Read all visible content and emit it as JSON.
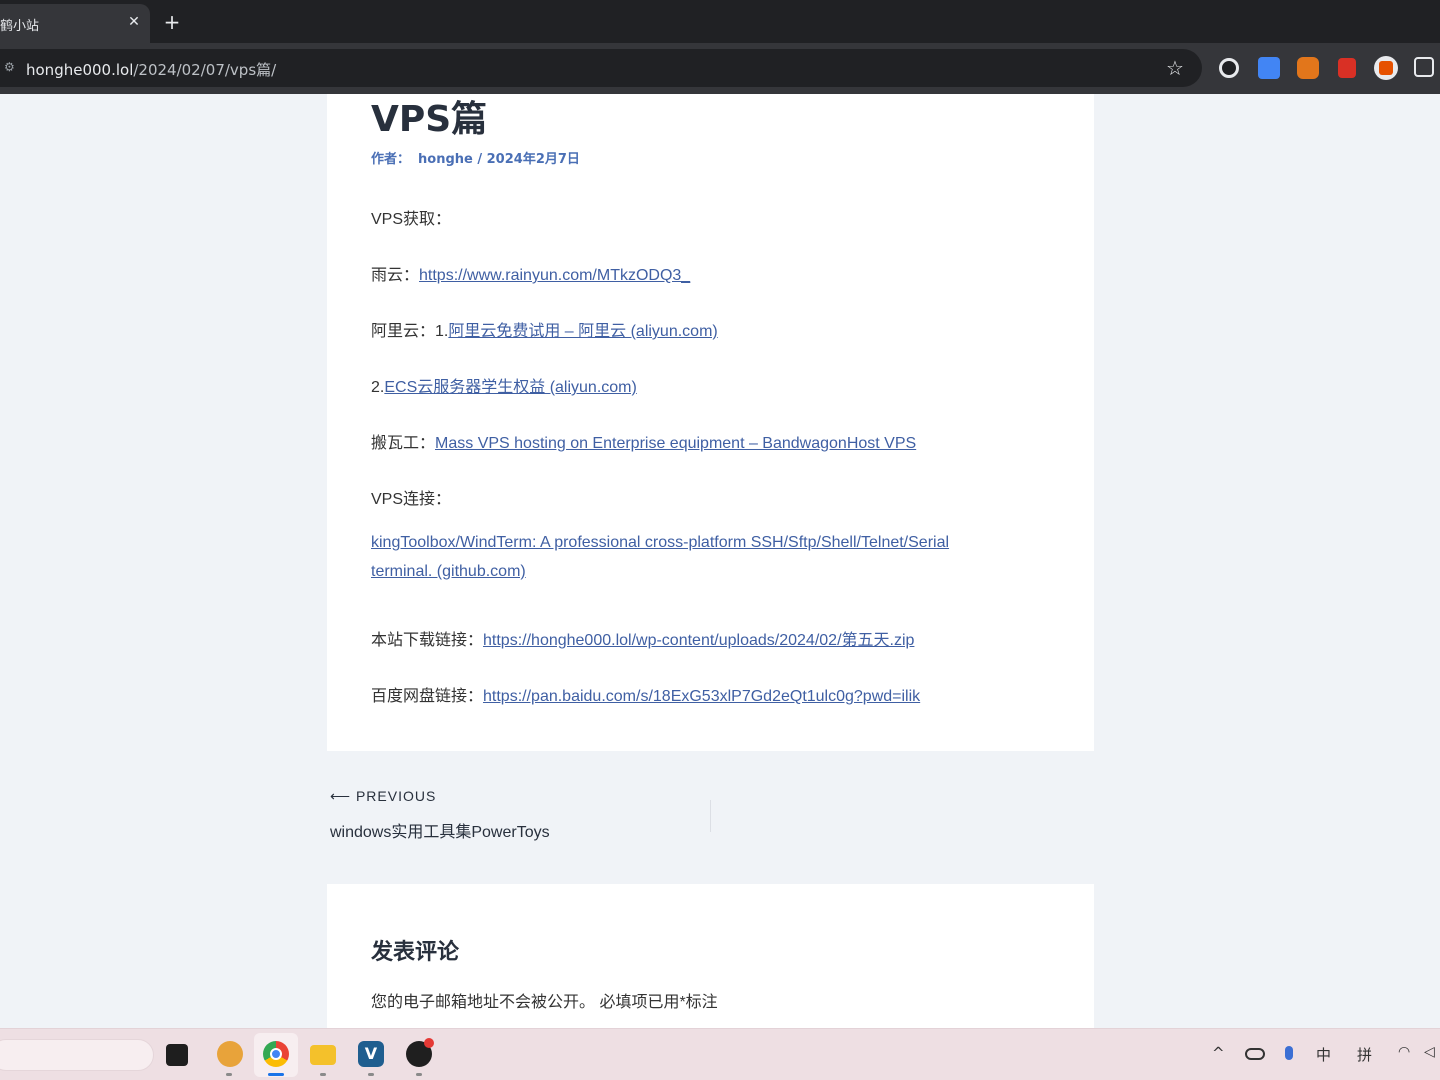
{
  "browser": {
    "tab_title": "鹤小站",
    "tab_close": "✕",
    "new_tab": "+",
    "url_host": "honghe000.lol",
    "url_path": "/2024/02/07/vps篇/",
    "icons": [
      "site-info-icon",
      "star-icon",
      "extension-icons"
    ]
  },
  "post": {
    "title": "VPS篇",
    "meta_author_label": "作者：",
    "meta_author_date": "honghe / 2024年2月7日",
    "lines": [
      {
        "prefix": "VPS获取：",
        "link": ""
      },
      {
        "prefix": "雨云：",
        "link": "https://www.rainyun.com/MTkzODQ3_"
      },
      {
        "prefix": "阿里云：1.",
        "link": "阿里云免费试用 – 阿里云 (aliyun.com)"
      },
      {
        "prefix": "2.",
        "link": "ECS云服务器学生权益 (aliyun.com)"
      },
      {
        "prefix": "搬瓦工：",
        "link": "Mass VPS hosting on Enterprise equipment – BandwagonHost VPS"
      },
      {
        "prefix": "VPS连接：",
        "link": ""
      },
      {
        "prefix": "",
        "link": "kingToolbox/WindTerm: A professional cross-platform SSH/Sftp/Shell/Telnet/Serial terminal. (github.com)"
      },
      {
        "prefix": "本站下载链接：",
        "link": "https://honghe000.lol/wp-content/uploads/2024/02/第五天.zip"
      },
      {
        "prefix": "百度网盘链接：",
        "link": "https://pan.baidu.com/s/18ExG53xlP7Gd2eQt1ulc0g?pwd=ilik"
      }
    ]
  },
  "post_nav": {
    "previous_label": "⟵ PREVIOUS",
    "previous_title": "windows实用工具集PowerToys"
  },
  "comments": {
    "title": "发表评论",
    "note": "您的电子邮箱地址不会被公开。 必填项已用*标注"
  },
  "taskbar": {
    "tray_ime": "中",
    "tray_pinyin": "拼",
    "tray_chevron": "^",
    "tb_v_label": "V"
  }
}
